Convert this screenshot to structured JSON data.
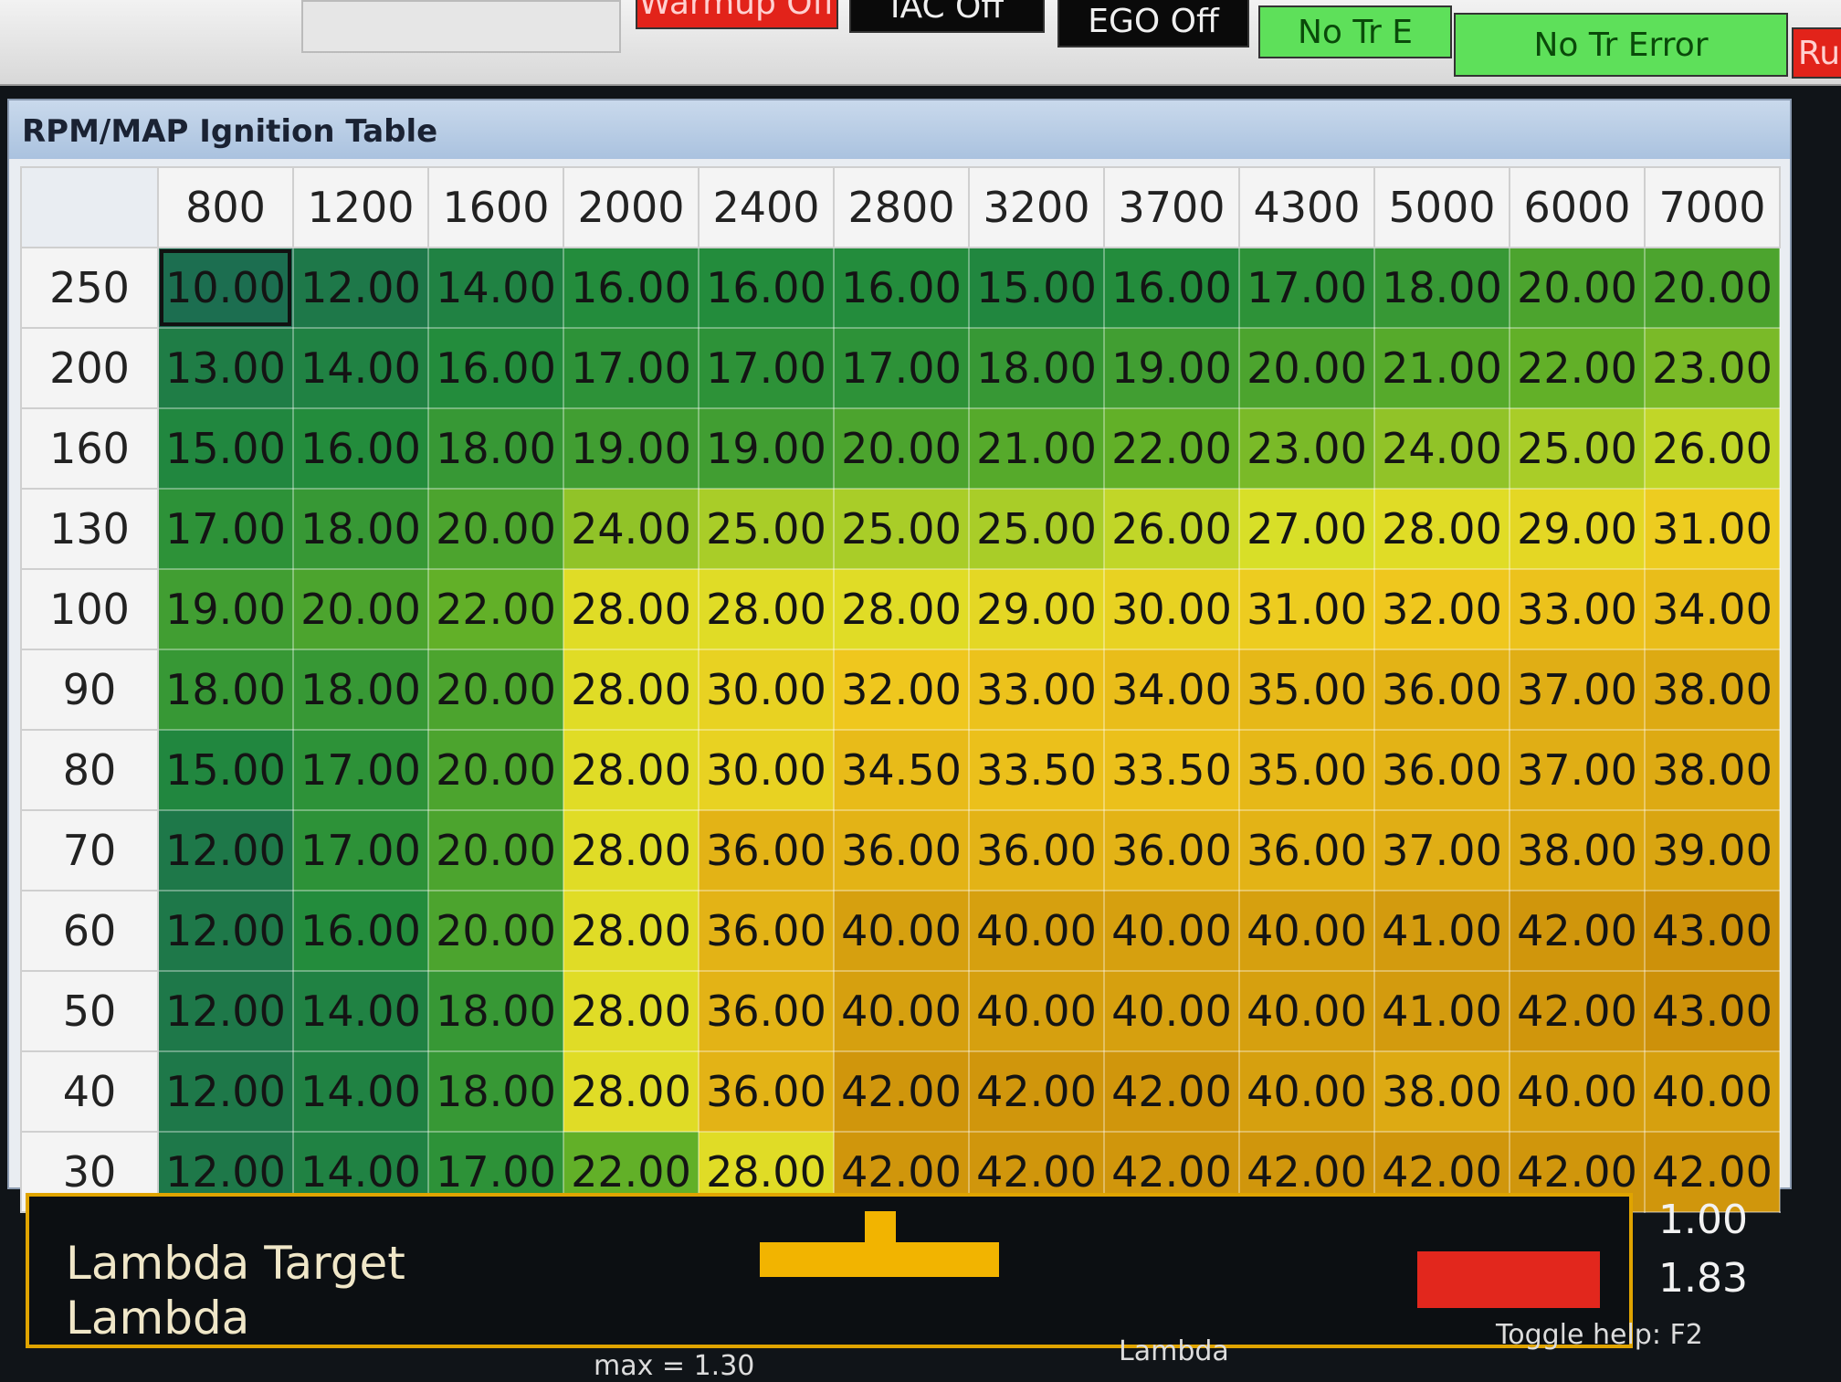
{
  "indicators": [
    {
      "label": "Warmup Off",
      "style": "off-red"
    },
    {
      "label": "IAC Off",
      "style": "off-black"
    },
    {
      "label": "EGO Off",
      "style": "off-black"
    },
    {
      "label": "No Tr E",
      "style": "ok-green"
    },
    {
      "label": "No Tr Error",
      "style": "ok-green"
    },
    {
      "label": "Ru",
      "style": "off-red"
    }
  ],
  "table": {
    "title": "RPM/MAP Ignition Table",
    "rpm": [
      "800",
      "1200",
      "1600",
      "2000",
      "2400",
      "2800",
      "3200",
      "3700",
      "4300",
      "5000",
      "6000",
      "7000"
    ],
    "map": [
      "250",
      "200",
      "160",
      "130",
      "100",
      "90",
      "80",
      "70",
      "60",
      "50",
      "40",
      "30"
    ],
    "values": [
      [
        "10.00",
        "12.00",
        "14.00",
        "16.00",
        "16.00",
        "16.00",
        "15.00",
        "16.00",
        "17.00",
        "18.00",
        "20.00",
        "20.00"
      ],
      [
        "13.00",
        "14.00",
        "16.00",
        "17.00",
        "17.00",
        "17.00",
        "18.00",
        "19.00",
        "20.00",
        "21.00",
        "22.00",
        "23.00"
      ],
      [
        "15.00",
        "16.00",
        "18.00",
        "19.00",
        "19.00",
        "20.00",
        "21.00",
        "22.00",
        "23.00",
        "24.00",
        "25.00",
        "26.00"
      ],
      [
        "17.00",
        "18.00",
        "20.00",
        "24.00",
        "25.00",
        "25.00",
        "25.00",
        "26.00",
        "27.00",
        "28.00",
        "29.00",
        "31.00"
      ],
      [
        "19.00",
        "20.00",
        "22.00",
        "28.00",
        "28.00",
        "28.00",
        "29.00",
        "30.00",
        "31.00",
        "32.00",
        "33.00",
        "34.00"
      ],
      [
        "18.00",
        "18.00",
        "20.00",
        "28.00",
        "30.00",
        "32.00",
        "33.00",
        "34.00",
        "35.00",
        "36.00",
        "37.00",
        "38.00"
      ],
      [
        "15.00",
        "17.00",
        "20.00",
        "28.00",
        "30.00",
        "34.50",
        "33.50",
        "33.50",
        "35.00",
        "36.00",
        "37.00",
        "38.00"
      ],
      [
        "12.00",
        "17.00",
        "20.00",
        "28.00",
        "36.00",
        "36.00",
        "36.00",
        "36.00",
        "36.00",
        "37.00",
        "38.00",
        "39.00"
      ],
      [
        "12.00",
        "16.00",
        "20.00",
        "28.00",
        "36.00",
        "40.00",
        "40.00",
        "40.00",
        "40.00",
        "41.00",
        "42.00",
        "43.00"
      ],
      [
        "12.00",
        "14.00",
        "18.00",
        "28.00",
        "36.00",
        "40.00",
        "40.00",
        "40.00",
        "40.00",
        "41.00",
        "42.00",
        "43.00"
      ],
      [
        "12.00",
        "14.00",
        "18.00",
        "28.00",
        "36.00",
        "42.00",
        "42.00",
        "42.00",
        "40.00",
        "38.00",
        "40.00",
        "40.00"
      ],
      [
        "12.00",
        "14.00",
        "17.00",
        "22.00",
        "28.00",
        "42.00",
        "42.00",
        "42.00",
        "42.00",
        "42.00",
        "42.00",
        "42.00"
      ]
    ],
    "selected": "10.00"
  },
  "gauge": {
    "label_target": "Lambda Target",
    "label_lambda": "Lambda",
    "value_target": "1.00",
    "value_lambda": "1.83",
    "max_text": "max = 1.30",
    "axis_label": "Lambda",
    "help_text": "Toggle help: F2",
    "colors": {
      "bar": "#f2b400",
      "alert": "#e2271d",
      "frame": "#e0a400"
    }
  }
}
